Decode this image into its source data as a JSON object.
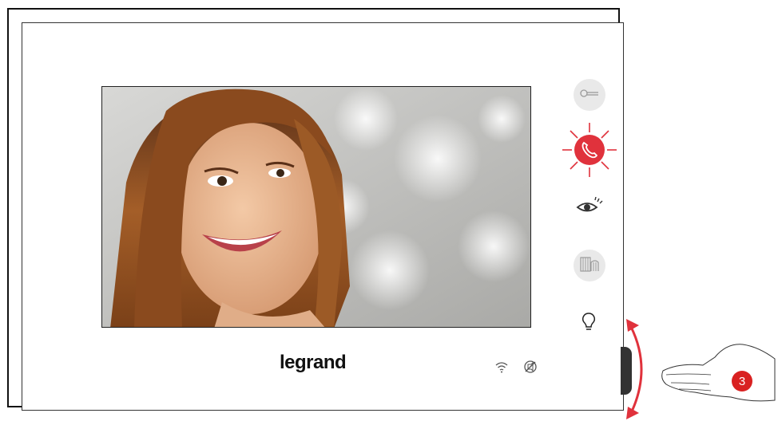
{
  "device": {
    "brand": "legrand",
    "step_number": "3"
  },
  "side_buttons": [
    {
      "name": "door-lock",
      "icon": "key-icon",
      "state": "idle"
    },
    {
      "name": "answer-call",
      "icon": "phone-icon",
      "state": "flashing",
      "color": "#e0323c"
    },
    {
      "name": "camera-view",
      "icon": "eye-icon",
      "state": "idle"
    },
    {
      "name": "camera-cycle",
      "icon": "gate-icon",
      "state": "idle"
    },
    {
      "name": "light",
      "icon": "bulb-icon",
      "state": "idle"
    }
  ],
  "status_icons": [
    "wifi-icon",
    "mute-icon"
  ],
  "colors": {
    "accent_red": "#e0323c",
    "badge_red": "#d92121",
    "icon_gray": "#9a9a9a"
  }
}
